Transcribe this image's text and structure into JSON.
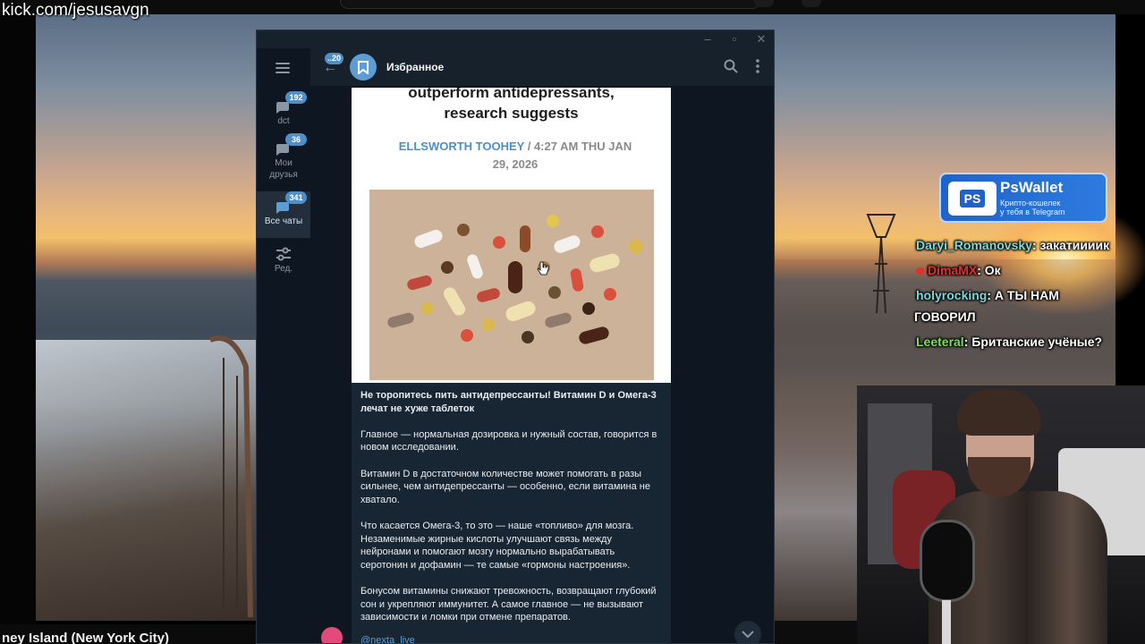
{
  "stream": {
    "url": "kick.com/jesusavgn",
    "caption": "ney Island (New York City)"
  },
  "telegram": {
    "sidebar": {
      "folders": [
        {
          "label": "dct",
          "badge": "192",
          "icon": "chat-bubbles-icon"
        },
        {
          "label": "Мои друзья",
          "badge": "36",
          "icon": "chat-bubbles-icon"
        },
        {
          "label": "Все чаты",
          "badge": "341",
          "icon": "chat-bubbles-icon",
          "active": true
        },
        {
          "label": "Ред.",
          "badge": "",
          "icon": "sliders-icon"
        }
      ]
    },
    "header": {
      "back_badge": "..20",
      "title": "Избранное"
    },
    "article": {
      "title_line1": "outperform antidepressants,",
      "title_line2": "research suggests",
      "author": "ELLSWORTH TOOHEY",
      "separator": "/",
      "date_part1": "4:27 AM THU JAN",
      "date_part2": "29, 2026"
    },
    "message": {
      "headline": "Не торопитесь пить антидепрессанты! Витамин D и Омега-3 лечат не хуже таблеток",
      "p1": "Главное — нормальная дозировка и нужный состав, говорится в новом исследовании.",
      "p2": "Витамин D в достаточном количестве может помогать в разы сильнее, чем антидепрессанты — особенно, если витамина не хватало.",
      "p3": "Что касается Омега-3, то это — наше «топливо» для мозга. Незаменимые жирные кислоты улучшают связь между нейронами и помогают мозгу нормально вырабатывать серотонин и дофамин — те самые «гормоны настроения».",
      "p4": "Бонусом витамины снижают тревожность, возвращают глубокий сон и укрепляют иммунитет. А самое главное — не вызывают зависимости и ломки при отмене препаратов.",
      "link": "@nexta_live"
    }
  },
  "ad": {
    "logo": "PS",
    "name": "PsWallet",
    "tagline_line1": "Крипто-кошелек",
    "tagline_line2": "у тебя в Telegram"
  },
  "stream_chat": [
    {
      "user": "Daryi_Romanovsky",
      "user_color": "#7fd8d8",
      "text": ": закатиииик",
      "badge": false
    },
    {
      "user": "DimaMX",
      "user_color": "#e03131",
      "text": ": Ок",
      "badge": true
    },
    {
      "user": "holyrocking",
      "user_color": "#7fd8d8",
      "text": ": А ТЫ НАМ",
      "badge": false
    },
    {
      "user": "",
      "user_color": "#ffffff",
      "text": "ГОВОРИЛ",
      "badge": false
    },
    {
      "user": "Leeteral",
      "user_color": "#7ee05a",
      "text": ": Британские учёные?",
      "badge": false
    }
  ],
  "colors": {
    "telegram_bg": "#0e1621",
    "telegram_panel": "#17212b",
    "accent": "#5c9ed3",
    "badge": "#4f8fc6"
  }
}
